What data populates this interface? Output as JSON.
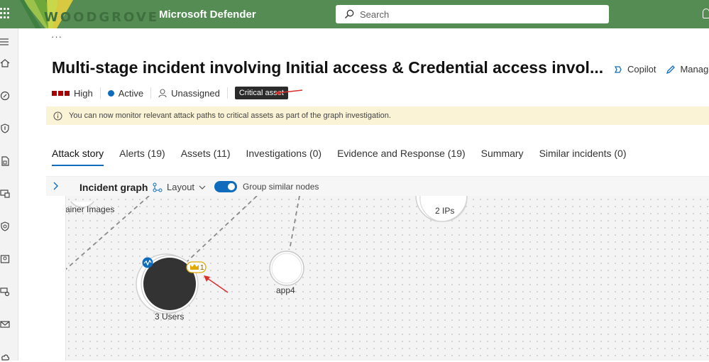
{
  "topbar": {
    "logo_text": "WOODGROVE",
    "app_name": "Microsoft Defender",
    "search_placeholder": "Search"
  },
  "page": {
    "ellipsis": "···",
    "title": "Multi-stage incident involving Initial access & Credential access invol...",
    "actions": [
      {
        "label": "Copilot",
        "icon": "copilot-icon"
      },
      {
        "label": "Manage",
        "icon": "edit-icon"
      }
    ],
    "severity": "High",
    "status": "Active",
    "assignee": "Unassigned",
    "tag": "Critical asset",
    "banner": "You can now monitor relevant attack paths to critical assets as part of the graph investigation."
  },
  "tabs": [
    {
      "label": "Attack story",
      "active": true
    },
    {
      "label": "Alerts (19)"
    },
    {
      "label": "Assets (11)"
    },
    {
      "label": "Investigations (0)"
    },
    {
      "label": "Evidence and Response (19)"
    },
    {
      "label": "Summary"
    },
    {
      "label": "Similar incidents (0)"
    }
  ],
  "graph_toolbar": {
    "title": "Incident graph",
    "layout_label": "Layout",
    "group_label": "Group similar nodes",
    "group_enabled": true
  },
  "graph": {
    "nodes": {
      "container_images": "ainer Images",
      "ips": "2 IPs",
      "users": "3 Users",
      "app": "app4",
      "crown_count": "1"
    }
  },
  "colors": {
    "topbar": "#548c54",
    "accent": "#0f6cbd",
    "severity_high": "#a80000",
    "annotation_arrow": "#d9302c",
    "critical_badge": "#2b2b2b"
  }
}
